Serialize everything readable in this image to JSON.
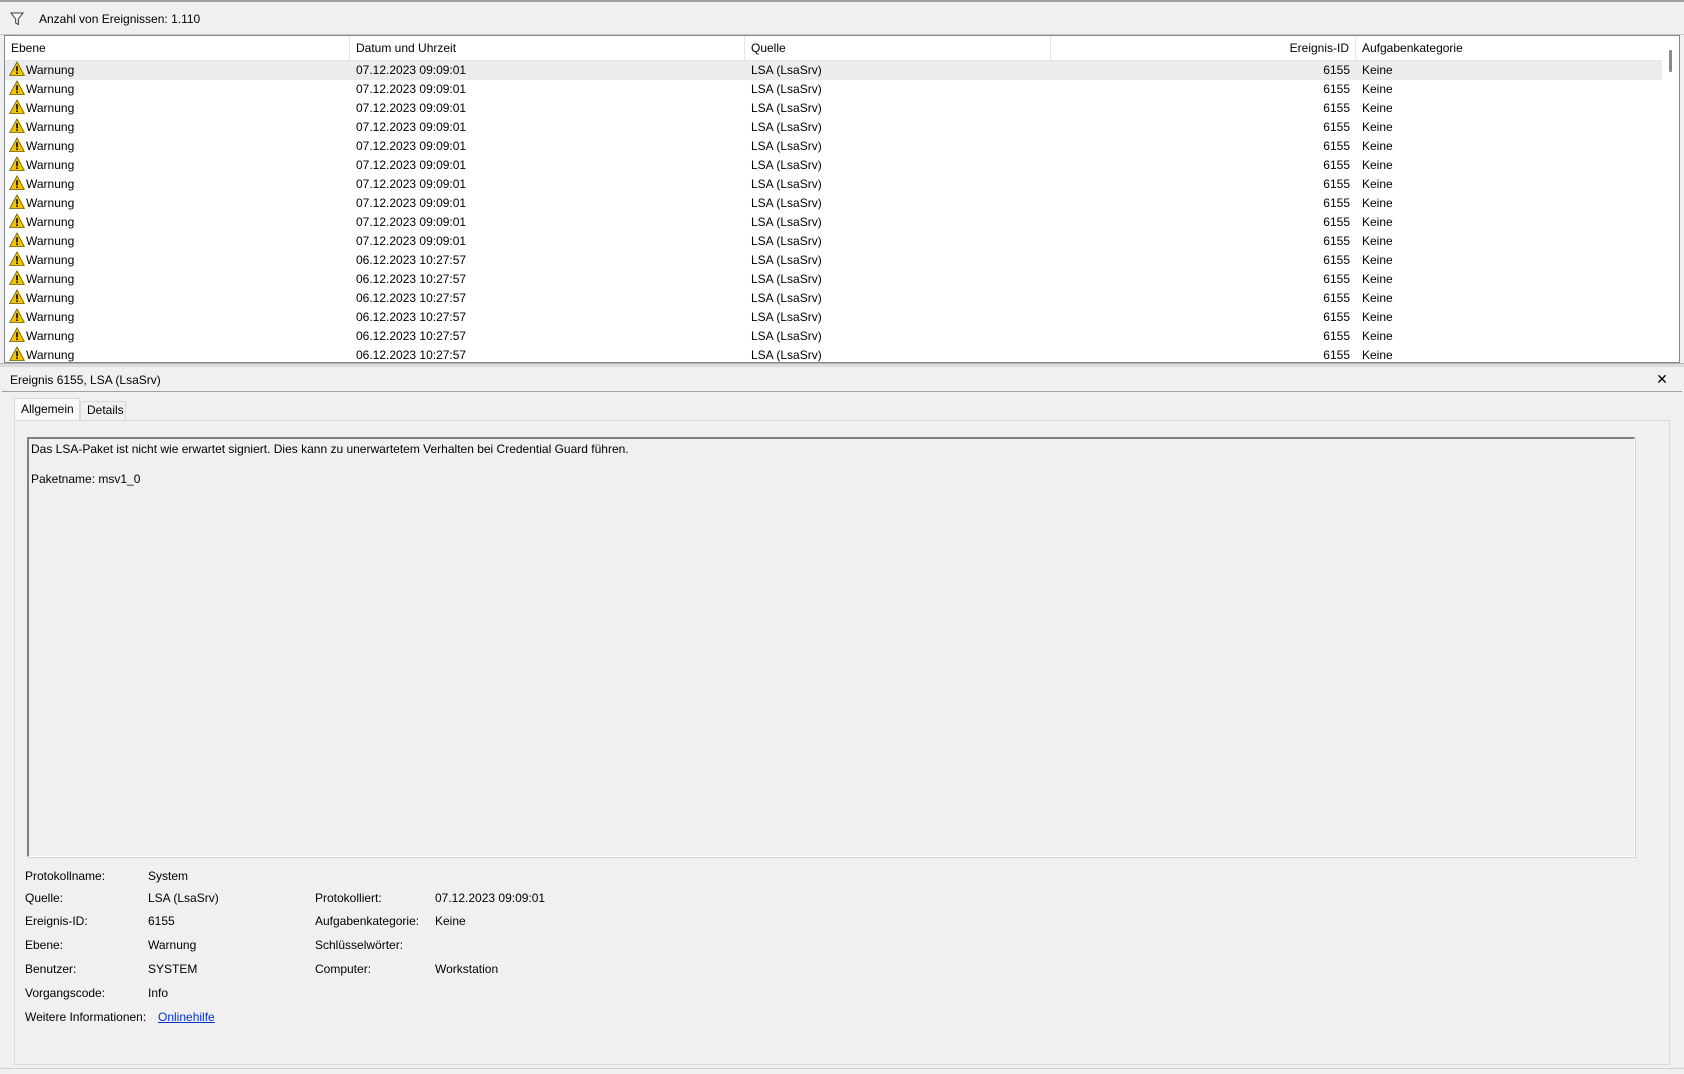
{
  "filter_bar": {
    "icon": "funnel-icon",
    "count_text": "Anzahl von Ereignissen: 1.110"
  },
  "list": {
    "columns": [
      "Ebene",
      "Datum und Uhrzeit",
      "Quelle",
      "Ereignis-ID",
      "Aufgabenkategorie"
    ],
    "level_icon": "warning-triangle-icon",
    "rows": [
      {
        "level": "Warnung",
        "datetime": "07.12.2023 09:09:01",
        "source": "LSA (LsaSrv)",
        "id": "6155",
        "category": "Keine"
      },
      {
        "level": "Warnung",
        "datetime": "07.12.2023 09:09:01",
        "source": "LSA (LsaSrv)",
        "id": "6155",
        "category": "Keine"
      },
      {
        "level": "Warnung",
        "datetime": "07.12.2023 09:09:01",
        "source": "LSA (LsaSrv)",
        "id": "6155",
        "category": "Keine"
      },
      {
        "level": "Warnung",
        "datetime": "07.12.2023 09:09:01",
        "source": "LSA (LsaSrv)",
        "id": "6155",
        "category": "Keine"
      },
      {
        "level": "Warnung",
        "datetime": "07.12.2023 09:09:01",
        "source": "LSA (LsaSrv)",
        "id": "6155",
        "category": "Keine"
      },
      {
        "level": "Warnung",
        "datetime": "07.12.2023 09:09:01",
        "source": "LSA (LsaSrv)",
        "id": "6155",
        "category": "Keine"
      },
      {
        "level": "Warnung",
        "datetime": "07.12.2023 09:09:01",
        "source": "LSA (LsaSrv)",
        "id": "6155",
        "category": "Keine"
      },
      {
        "level": "Warnung",
        "datetime": "07.12.2023 09:09:01",
        "source": "LSA (LsaSrv)",
        "id": "6155",
        "category": "Keine"
      },
      {
        "level": "Warnung",
        "datetime": "07.12.2023 09:09:01",
        "source": "LSA (LsaSrv)",
        "id": "6155",
        "category": "Keine"
      },
      {
        "level": "Warnung",
        "datetime": "07.12.2023 09:09:01",
        "source": "LSA (LsaSrv)",
        "id": "6155",
        "category": "Keine"
      },
      {
        "level": "Warnung",
        "datetime": "06.12.2023 10:27:57",
        "source": "LSA (LsaSrv)",
        "id": "6155",
        "category": "Keine"
      },
      {
        "level": "Warnung",
        "datetime": "06.12.2023 10:27:57",
        "source": "LSA (LsaSrv)",
        "id": "6155",
        "category": "Keine"
      },
      {
        "level": "Warnung",
        "datetime": "06.12.2023 10:27:57",
        "source": "LSA (LsaSrv)",
        "id": "6155",
        "category": "Keine"
      },
      {
        "level": "Warnung",
        "datetime": "06.12.2023 10:27:57",
        "source": "LSA (LsaSrv)",
        "id": "6155",
        "category": "Keine"
      },
      {
        "level": "Warnung",
        "datetime": "06.12.2023 10:27:57",
        "source": "LSA (LsaSrv)",
        "id": "6155",
        "category": "Keine"
      },
      {
        "level": "Warnung",
        "datetime": "06.12.2023 10:27:57",
        "source": "LSA (LsaSrv)",
        "id": "6155",
        "category": "Keine"
      }
    ]
  },
  "detail": {
    "title": "Ereignis 6155, LSA (LsaSrv)",
    "close_icon": "close-icon",
    "tabs": [
      "Allgemein",
      "Details"
    ],
    "message_line1": "Das LSA-Paket ist nicht wie erwartet signiert. Dies kann zu unerwartetem Verhalten bei Credential Guard führen.",
    "message_line2": "Paketname: msv1_0",
    "properties": {
      "protokollname": {
        "label": "Protokollname:",
        "value": "System"
      },
      "quelle": {
        "label": "Quelle:",
        "value": "LSA (LsaSrv)"
      },
      "protokolliert": {
        "label": "Protokolliert:",
        "value": "07.12.2023 09:09:01"
      },
      "ereignis_id": {
        "label": "Ereignis-ID:",
        "value": "6155"
      },
      "aufgabenkategorie": {
        "label": "Aufgabenkategorie:",
        "value": "Keine"
      },
      "ebene": {
        "label": "Ebene:",
        "value": "Warnung"
      },
      "schluesselwoerter": {
        "label": "Schlüsselwörter:",
        "value": ""
      },
      "benutzer": {
        "label": "Benutzer:",
        "value": "SYSTEM"
      },
      "computer": {
        "label": "Computer:",
        "value": "Workstation"
      },
      "vorgangscode": {
        "label": "Vorgangscode:",
        "value": "Info"
      },
      "weitere_informationen": {
        "label": "Weitere Informationen:",
        "value": "Onlinehilfe"
      }
    }
  },
  "colors": {
    "warning_fill": "#f3c400",
    "link": "#0033cc",
    "selected_row": "#ececec"
  }
}
